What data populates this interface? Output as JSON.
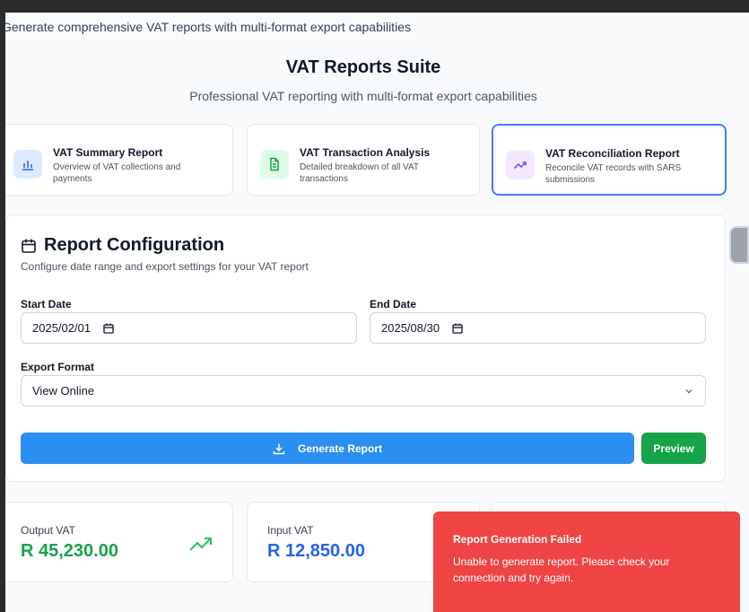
{
  "page": {
    "subtitle": "Generate comprehensive VAT reports with multi-format export capabilities"
  },
  "suite": {
    "title": "VAT Reports Suite",
    "subtitle": "Professional VAT reporting with multi-format export capabilities"
  },
  "report_types": [
    {
      "title": "VAT Summary Report",
      "description": "Overview of VAT collections and payments",
      "icon": "bar-chart-icon",
      "color": "#2563eb"
    },
    {
      "title": "VAT Transaction Analysis",
      "description": "Detailed breakdown of all VAT transactions",
      "icon": "document-icon",
      "color": "#16a34a"
    },
    {
      "title": "VAT Reconciliation Report",
      "description": "Reconcile VAT records with SARS submissions",
      "icon": "trending-up-icon",
      "color": "#7c3aed",
      "selected": true
    }
  ],
  "config": {
    "title": "Report Configuration",
    "description": "Configure date range and export settings for your VAT report",
    "start_label": "Start Date",
    "start_value": "2025/02/01",
    "end_label": "End Date",
    "end_value": "2025/08/30",
    "format_label": "Export Format",
    "format_value": "View Online",
    "generate_label": "Generate Report",
    "preview_label": "Preview"
  },
  "stats": [
    {
      "label": "Output VAT",
      "value": "R 45,230.00",
      "color": "#16a34a"
    },
    {
      "label": "Input VAT",
      "value": "R 12,850.00",
      "color": "#2563eb"
    }
  ],
  "toast": {
    "title": "Report Generation Failed",
    "message": "Unable to generate report. Please check your connection and try again.",
    "color": "#ef4444"
  }
}
